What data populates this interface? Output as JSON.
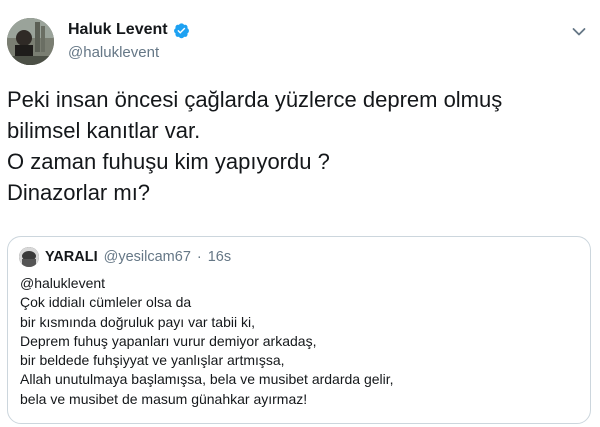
{
  "tweet": {
    "author": {
      "display_name": "Haluk Levent",
      "handle": "@haluklevent",
      "verified": true
    },
    "text_lines": [
      "Peki insan öncesi çağlarda yüzlerce deprem olmuş",
      "bilimsel kanıtlar var.",
      "O zaman fuhuşu kim yapıyordu ?",
      "Dinazorlar mı?"
    ],
    "icons": {
      "verified": "verified-badge-icon",
      "menu": "chevron-down-icon"
    },
    "colors": {
      "verified_blue": "#1da1f2",
      "secondary_text": "#657786",
      "border": "#ccd6dd"
    }
  },
  "quoted_tweet": {
    "display_name": "YARALI",
    "handle": "@yesilcam67",
    "separator": "·",
    "time": "16s",
    "body_lines": [
      "@haluklevent",
      "Çok iddialı cümleler olsa da",
      "bir kısmında doğruluk payı var tabii ki,",
      "Deprem fuhuş yapanları vurur demiyor arkadaş,",
      "bir beldede fuhşiyyat ve yanlışlar artmışsa,",
      "Allah unutulmaya başlamışsa, bela ve musibet ardarda gelir,",
      "bela ve musibet de masum günahkar ayırmaz!"
    ]
  }
}
